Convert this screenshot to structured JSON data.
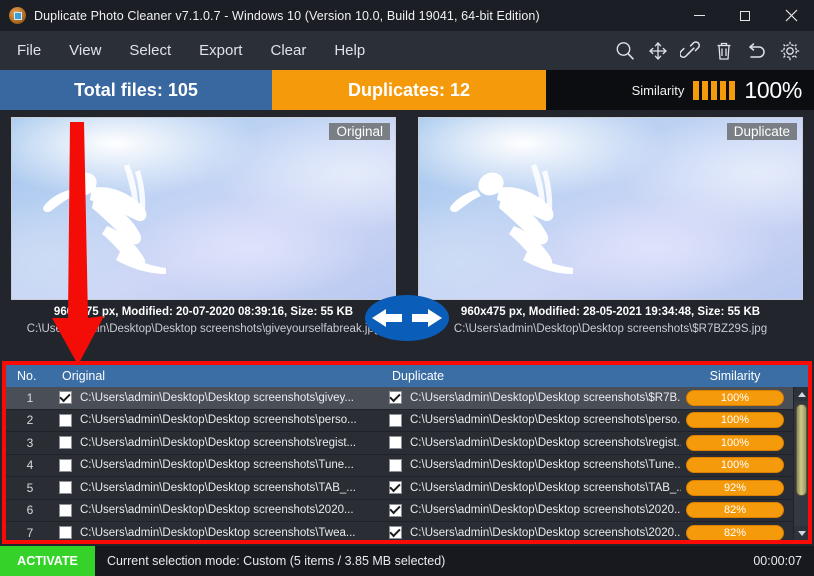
{
  "window": {
    "title": "Duplicate Photo Cleaner v7.1.0.7 - Windows 10 (Version 10.0, Build 19041, 64-bit Edition)",
    "app_icon": "photo-app-icon",
    "minimize": "minimize-icon",
    "maximize": "maximize-icon",
    "close": "close-icon"
  },
  "menubar": {
    "items": [
      {
        "label": "File"
      },
      {
        "label": "View"
      },
      {
        "label": "Select"
      },
      {
        "label": "Export"
      },
      {
        "label": "Clear"
      },
      {
        "label": "Help"
      }
    ],
    "tools": [
      {
        "name": "search-icon"
      },
      {
        "name": "move-icon"
      },
      {
        "name": "link-icon"
      },
      {
        "name": "trash-icon"
      },
      {
        "name": "undo-icon"
      },
      {
        "name": "gear-icon"
      }
    ]
  },
  "stats": {
    "total_files": "Total files: 105",
    "duplicates": "Duplicates: 12",
    "similarity_label": "Similarity",
    "similarity_value": "100%",
    "similarity_bars": 5,
    "colors": {
      "total_bg": "#39679f",
      "duplicates_bg": "#f59a0b",
      "similarity_bar": "#f59a0b",
      "activate_bg": "#35d22a",
      "annotation_red": "#fa0b06",
      "header_blue": "#3a6ea5"
    }
  },
  "previews": {
    "left": {
      "tag": "Original",
      "meta": "960x475 px, Modified: 20-07-2020 08:39:16, Size: 55 KB",
      "path": "C:\\Users\\admin\\Desktop\\Desktop screenshots\\giveyourselfabreak.jpg"
    },
    "right": {
      "tag": "Duplicate",
      "meta": "960x475 px, Modified: 28-05-2021 19:34:48, Size: 55 KB",
      "path": "C:\\Users\\admin\\Desktop\\Desktop screenshots\\$R7BZ29S.jpg"
    },
    "swap_icon": "swap-left-right-arrows-icon"
  },
  "table": {
    "headers": {
      "no": "No.",
      "original": "Original",
      "duplicate": "Duplicate",
      "similarity": "Similarity"
    },
    "rows": [
      {
        "no": "1",
        "orig_checked": true,
        "orig_path": "C:\\Users\\admin\\Desktop\\Desktop screenshots\\givey...",
        "dup_checked": true,
        "dup_path": "C:\\Users\\admin\\Desktop\\Desktop screenshots\\$R7B...",
        "similarity": "100%",
        "selected": true
      },
      {
        "no": "2",
        "orig_checked": false,
        "orig_path": "C:\\Users\\admin\\Desktop\\Desktop screenshots\\perso...",
        "dup_checked": false,
        "dup_path": "C:\\Users\\admin\\Desktop\\Desktop screenshots\\perso...",
        "similarity": "100%",
        "selected": false
      },
      {
        "no": "3",
        "orig_checked": false,
        "orig_path": "C:\\Users\\admin\\Desktop\\Desktop screenshots\\regist...",
        "dup_checked": false,
        "dup_path": "C:\\Users\\admin\\Desktop\\Desktop screenshots\\regist...",
        "similarity": "100%",
        "selected": false
      },
      {
        "no": "4",
        "orig_checked": false,
        "orig_path": "C:\\Users\\admin\\Desktop\\Desktop screenshots\\Tune...",
        "dup_checked": false,
        "dup_path": "C:\\Users\\admin\\Desktop\\Desktop screenshots\\Tune...",
        "similarity": "100%",
        "selected": false
      },
      {
        "no": "5",
        "orig_checked": false,
        "orig_path": "C:\\Users\\admin\\Desktop\\Desktop screenshots\\TAB_...",
        "dup_checked": true,
        "dup_path": "C:\\Users\\admin\\Desktop\\Desktop screenshots\\TAB_...",
        "similarity": "92%",
        "selected": false
      },
      {
        "no": "6",
        "orig_checked": false,
        "orig_path": "C:\\Users\\admin\\Desktop\\Desktop screenshots\\2020...",
        "dup_checked": true,
        "dup_path": "C:\\Users\\admin\\Desktop\\Desktop screenshots\\2020...",
        "similarity": "82%",
        "selected": false
      },
      {
        "no": "7",
        "orig_checked": false,
        "orig_path": "C:\\Users\\admin\\Desktop\\Desktop screenshots\\Twea...",
        "dup_checked": true,
        "dup_path": "C:\\Users\\admin\\Desktop\\Desktop screenshots\\2020...",
        "similarity": "82%",
        "selected": false
      }
    ]
  },
  "statusbar": {
    "activate": "ACTIVATE",
    "selection_mode": "Current selection mode: Custom (5 items / 3.85 MB selected)",
    "timer": "00:00:07"
  }
}
